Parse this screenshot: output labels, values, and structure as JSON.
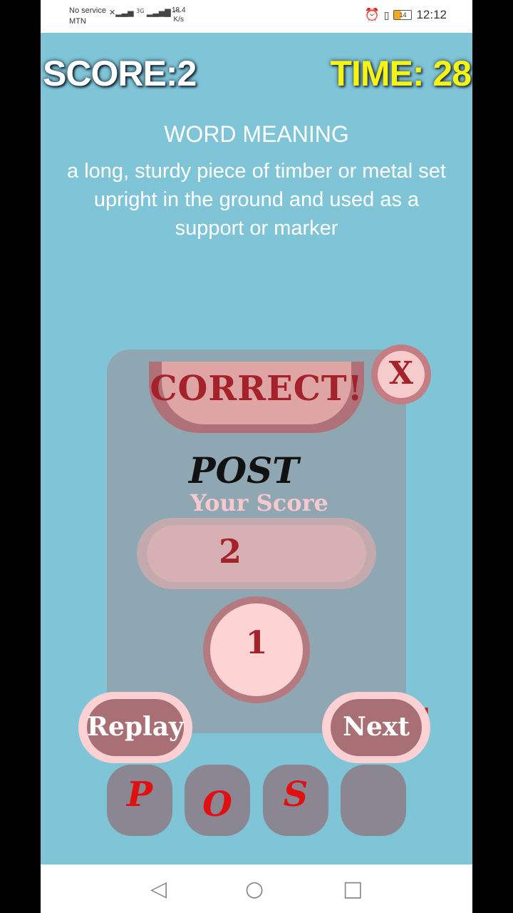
{
  "status_bar": {
    "operator_line1": "No service",
    "operator_line2": "MTN",
    "network_type": "3G",
    "speed_value": "18.4",
    "speed_unit": "K/s",
    "battery_level": "14",
    "time": "12:12"
  },
  "hud": {
    "score": "SCORE:2",
    "timer": "TIME: 28"
  },
  "word_meaning": {
    "title": "WORD MEANING",
    "definition": "a long, sturdy piece of timber or metal set upright in the ground and used as a support or marker"
  },
  "result_dialog": {
    "banner": "CORRECT!",
    "close_label": "X",
    "word": "POST",
    "your_score_label": "Your Score",
    "score_value": "2",
    "round_value": "1",
    "replay_label": "Replay",
    "next_label": "Next"
  },
  "letter_tiles": [
    "P",
    "O",
    "S",
    ""
  ],
  "colors": {
    "background": "#7fc5d7",
    "score_text": "#ffffff",
    "timer_text": "#f5f514",
    "accent_red": "#a4222a",
    "tile_letter": "#e01010"
  },
  "nav": {
    "back_icon": "◁",
    "home_icon": "○",
    "recents_icon": "□"
  }
}
